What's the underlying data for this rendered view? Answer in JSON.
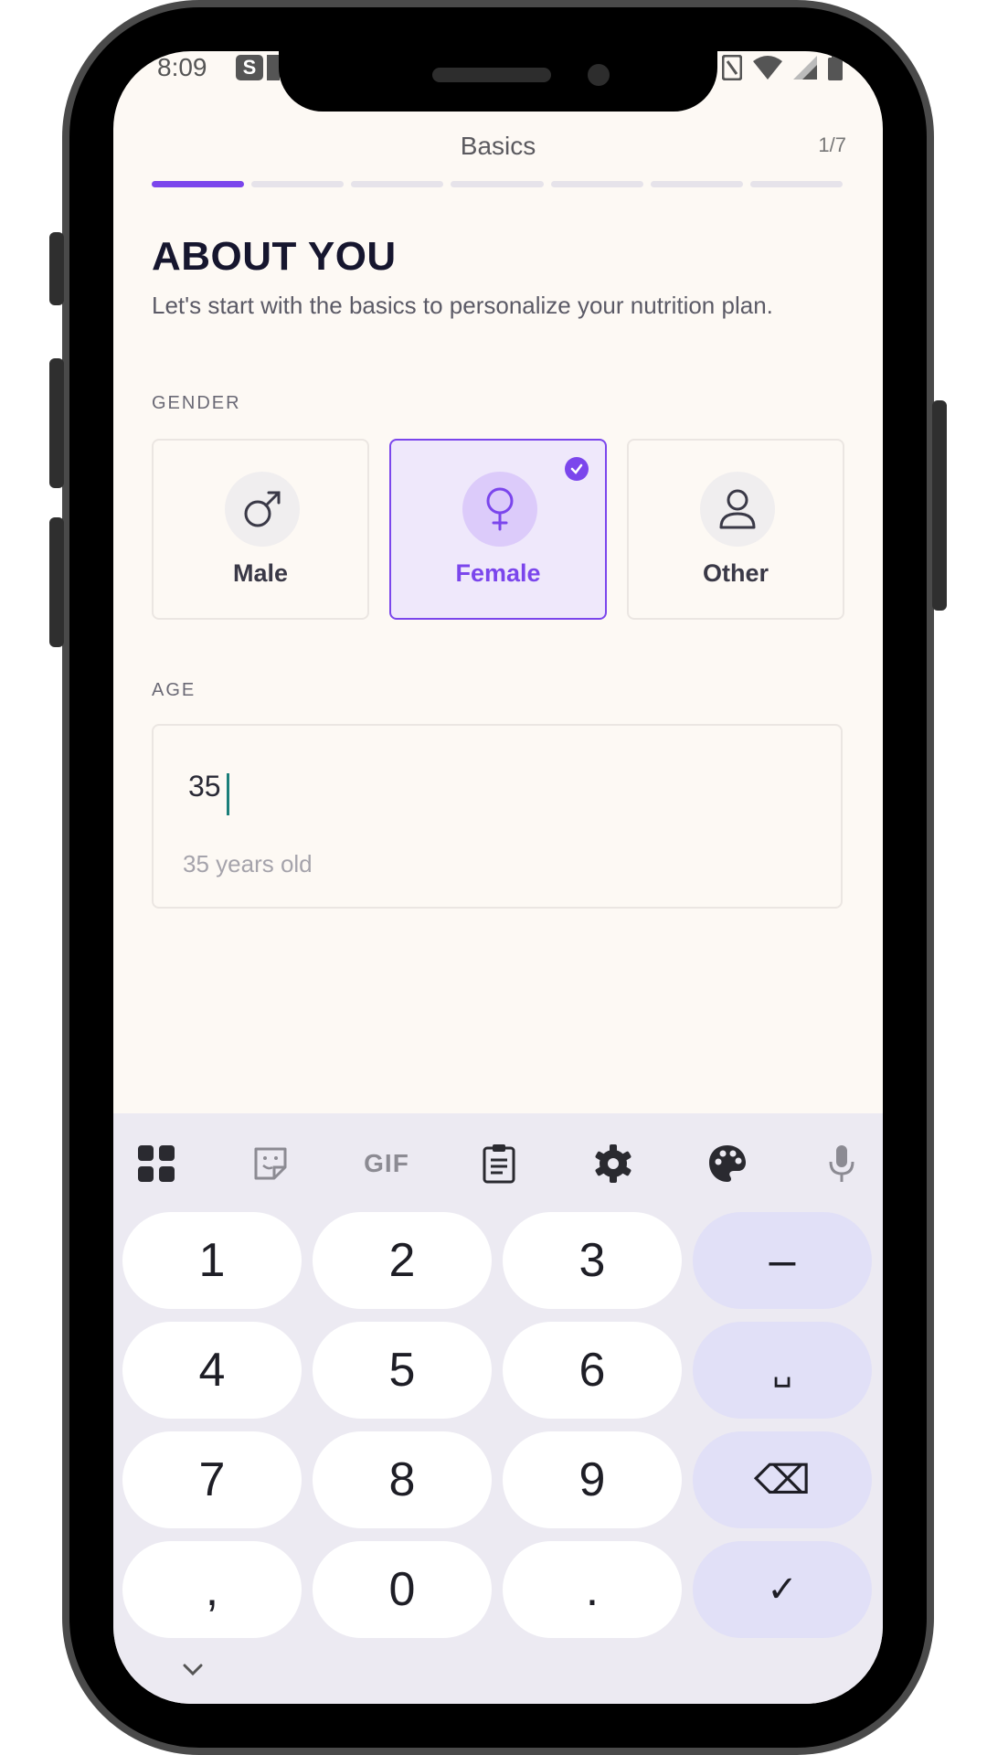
{
  "status_bar": {
    "time": "8:09",
    "s_badge": "S"
  },
  "header": {
    "title": "Basics",
    "step": "1/7",
    "progress_total": 7,
    "progress_current": 1
  },
  "intro": {
    "heading": "ABOUT YOU",
    "subtitle": "Let's start with the basics to personalize your nutrition plan."
  },
  "gender": {
    "label": "GENDER",
    "options": [
      {
        "label": "Male",
        "icon": "male-icon",
        "selected": false
      },
      {
        "label": "Female",
        "icon": "female-icon",
        "selected": true
      },
      {
        "label": "Other",
        "icon": "person-icon",
        "selected": false
      }
    ]
  },
  "age": {
    "label": "AGE",
    "value": "35",
    "hint": "35 years old"
  },
  "keyboard": {
    "toolbar": [
      "apps-icon",
      "sticker-icon",
      "gif-icon",
      "clipboard-icon",
      "gear-icon",
      "palette-icon",
      "microphone-icon"
    ],
    "gif_label": "GIF",
    "rows": [
      [
        "1",
        "2",
        "3",
        "–"
      ],
      [
        "4",
        "5",
        "6",
        "␣"
      ],
      [
        "7",
        "8",
        "9",
        "⌫"
      ],
      [
        ",",
        "0",
        ".",
        "✓"
      ]
    ]
  },
  "colors": {
    "accent": "#7b46ec",
    "background": "#fdf9f4",
    "keyboard_bg": "#eceaf2"
  }
}
